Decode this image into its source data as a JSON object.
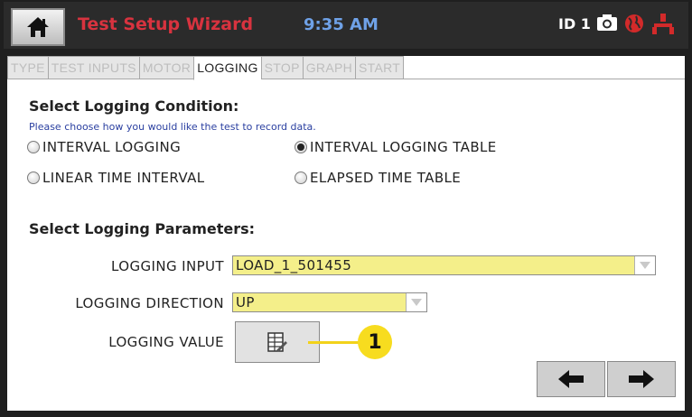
{
  "header": {
    "title": "Test Setup Wizard",
    "time": "9:35 AM",
    "id_label": "ID 1",
    "icons": [
      "home-icon",
      "camera-icon",
      "globe-icon",
      "network-icon"
    ]
  },
  "tabs": [
    {
      "label": "TYPE",
      "active": false
    },
    {
      "label": "TEST INPUTS",
      "active": false
    },
    {
      "label": "MOTOR",
      "active": false
    },
    {
      "label": "LOGGING",
      "active": true
    },
    {
      "label": "STOP",
      "active": false
    },
    {
      "label": "GRAPH",
      "active": false
    },
    {
      "label": "START",
      "active": false
    }
  ],
  "logging_condition": {
    "title": "Select Logging Condition:",
    "hint": "Please choose how you would like the test to record data.",
    "options": [
      {
        "label": "INTERVAL LOGGING",
        "checked": false
      },
      {
        "label": "INTERVAL LOGGING TABLE",
        "checked": true
      },
      {
        "label": "LINEAR TIME INTERVAL",
        "checked": false
      },
      {
        "label": "ELAPSED TIME TABLE",
        "checked": false
      }
    ]
  },
  "logging_parameters": {
    "title": "Select Logging Parameters:",
    "input_label": "LOGGING INPUT",
    "input_value": "LOAD_1_501455",
    "direction_label": "LOGGING DIRECTION",
    "direction_value": "UP",
    "value_label": "LOGGING VALUE"
  },
  "callout": "1",
  "colors": {
    "title_red": "#d8333f",
    "time_blue": "#6fa2e8",
    "field_yellow": "#f4ef8a",
    "callout_yellow": "#f7dc1f"
  }
}
